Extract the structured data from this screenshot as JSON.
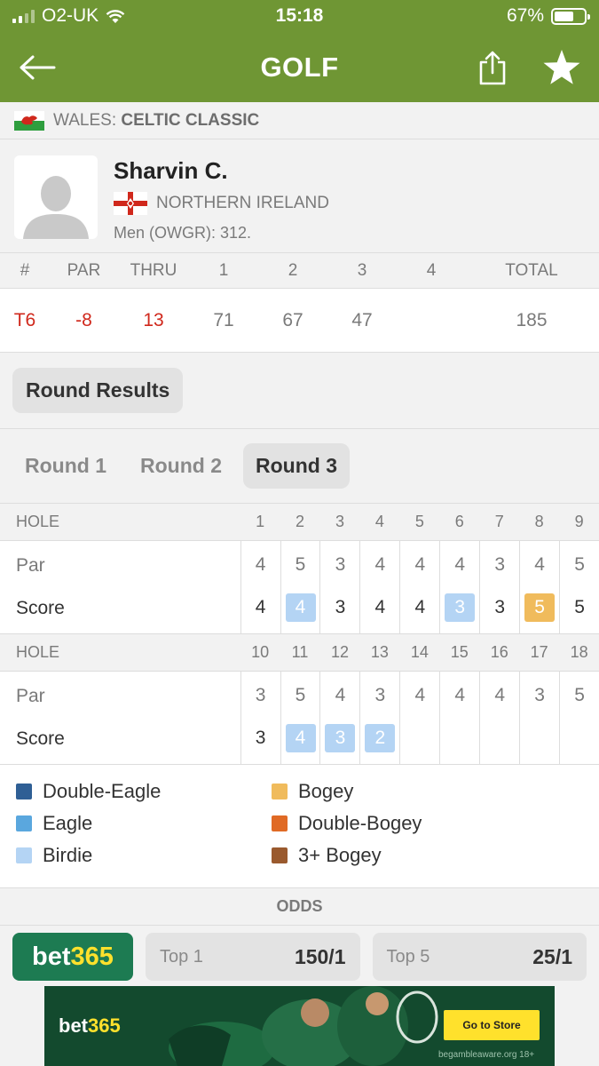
{
  "status": {
    "carrier": "O2-UK",
    "time": "15:18",
    "battery": "67%",
    "battery_level": 0.67
  },
  "nav": {
    "title": "GOLF",
    "back_icon": "back-arrow-icon",
    "share_icon": "share-icon",
    "favorite_icon": "star-icon"
  },
  "tournament": {
    "country": "WALES:",
    "name": "CELTIC CLASSIC"
  },
  "player": {
    "name": "Sharvin C.",
    "country": "NORTHERN IRELAND",
    "ranking": "Men (OWGR): 312."
  },
  "scoreboard": {
    "headers": [
      "#",
      "PAR",
      "THRU",
      "1",
      "2",
      "3",
      "4",
      "TOTAL"
    ],
    "values": [
      "T6",
      "-8",
      "13",
      "71",
      "67",
      "47",
      "",
      "185"
    ]
  },
  "round_results": {
    "label": "Round Results"
  },
  "rounds": [
    "Round 1",
    "Round 2",
    "Round 3"
  ],
  "holes": {
    "header_label": "HOLE",
    "par_label": "Par",
    "score_label": "Score",
    "front": {
      "numbers": [
        "1",
        "2",
        "3",
        "4",
        "5",
        "6",
        "7",
        "8",
        "9"
      ],
      "par": [
        "4",
        "5",
        "3",
        "4",
        "4",
        "4",
        "3",
        "4",
        "5"
      ],
      "score": [
        "4",
        "4",
        "3",
        "4",
        "4",
        "3",
        "3",
        "5",
        "5"
      ],
      "result": [
        "",
        "birdie",
        "",
        "",
        "",
        "birdie",
        "",
        "bogey",
        ""
      ]
    },
    "back": {
      "numbers": [
        "10",
        "11",
        "12",
        "13",
        "14",
        "15",
        "16",
        "17",
        "18"
      ],
      "par": [
        "3",
        "5",
        "4",
        "3",
        "4",
        "4",
        "4",
        "3",
        "5"
      ],
      "score": [
        "3",
        "4",
        "3",
        "2",
        "",
        "",
        "",
        "",
        ""
      ],
      "result": [
        "",
        "birdie",
        "birdie",
        "birdie",
        "",
        "",
        "",
        "",
        ""
      ]
    }
  },
  "legend": {
    "left": [
      {
        "label": "Double-Eagle",
        "color": "#2f5f95"
      },
      {
        "label": "Eagle",
        "color": "#5aa7de"
      },
      {
        "label": "Birdie",
        "color": "#b4d4f4"
      }
    ],
    "right": [
      {
        "label": "Bogey",
        "color": "#f0bb5c"
      },
      {
        "label": "Double-Bogey",
        "color": "#e06a25"
      },
      {
        "label": "3+ Bogey",
        "color": "#9a5a2e"
      }
    ]
  },
  "odds": {
    "header": "ODDS",
    "bookmaker_a": "bet",
    "bookmaker_b": "365",
    "items": [
      {
        "label": "Top 1",
        "value": "150/1"
      },
      {
        "label": "Top 5",
        "value": "25/1"
      }
    ]
  },
  "banner": {
    "logo_a": "bet",
    "logo_b": "365",
    "cta": "Go to Store",
    "disclaimer": "begambleaware.org 18+"
  }
}
